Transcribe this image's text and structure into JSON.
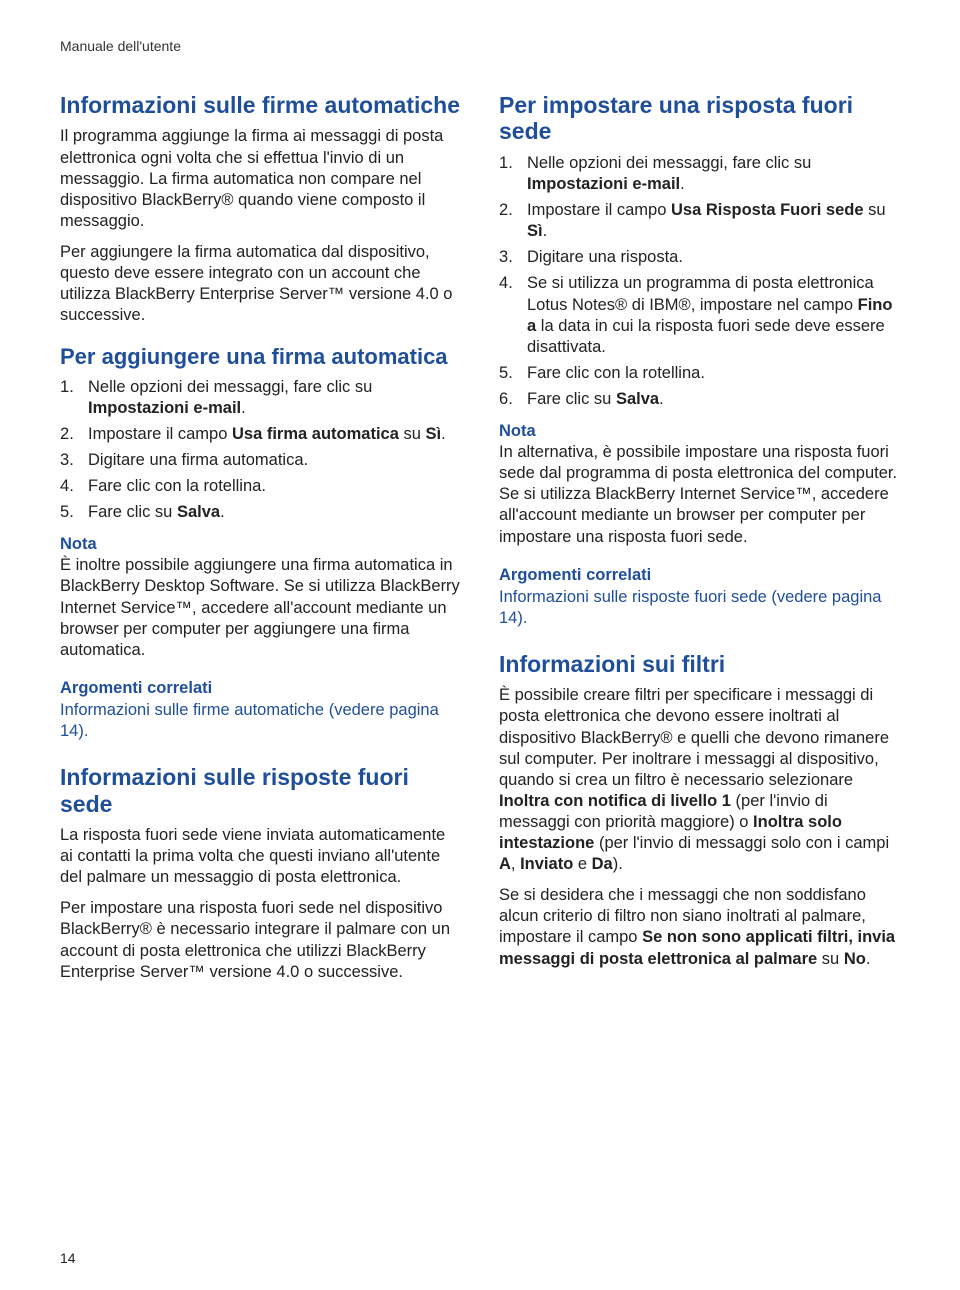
{
  "header": "Manuale dell'utente",
  "pageNumber": "14",
  "left": {
    "h1": "Informazioni sulle firme automatiche",
    "p1": "Il programma aggiunge la firma ai messaggi di posta elettronica ogni volta che si effettua l'invio di un messaggio. La firma automatica non compare nel dispositivo BlackBerry® quando viene composto il messaggio.",
    "p2": "Per aggiungere la firma automatica dal dispositivo, questo deve essere integrato con un account che utilizza BlackBerry Enterprise Server™ versione 4.0 o successive.",
    "h2": "Per aggiungere una firma automatica",
    "ol1_1a": "Nelle opzioni dei messaggi, fare clic su ",
    "ol1_1b": "Impostazioni e-mail",
    "ol1_1c": ".",
    "ol1_2a": "Impostare il campo ",
    "ol1_2b": "Usa firma automatica",
    "ol1_2c": " su ",
    "ol1_2d": "Sì",
    "ol1_2e": ".",
    "ol1_3": "Digitare una firma automatica.",
    "ol1_4": "Fare clic con la rotellina.",
    "ol1_5a": "Fare clic su ",
    "ol1_5b": "Salva",
    "ol1_5c": ".",
    "notaLabel": "Nota",
    "nota1": "È inoltre possibile aggiungere una firma automatica in BlackBerry Desktop Software. Se si utilizza BlackBerry Internet Service™, accedere all'account mediante un browser per computer per aggiungere una firma automatica.",
    "relatedLabel": "Argomenti correlati",
    "related1": "Informazioni sulle firme automatiche (vedere pagina 14).",
    "h3": "Informazioni sulle risposte fuori sede",
    "p3": "La risposta fuori sede viene inviata automaticamente ai contatti la prima volta che questi inviano all'utente del palmare un messaggio di posta elettronica.",
    "p4": "Per impostare una risposta fuori sede nel dispositivo BlackBerry® è necessario integrare il palmare con un account di posta elettronica che utilizzi BlackBerry Enterprise Server™ versione 4.0 o successive."
  },
  "right": {
    "h1": "Per impostare una risposta fuori sede",
    "ol1_1a": "Nelle opzioni dei messaggi, fare clic su ",
    "ol1_1b": "Impostazioni e-mail",
    "ol1_1c": ".",
    "ol1_2a": "Impostare il campo ",
    "ol1_2b": "Usa Risposta Fuori sede",
    "ol1_2c": " su ",
    "ol1_2d": "Sì",
    "ol1_2e": ".",
    "ol1_3": "Digitare una risposta.",
    "ol1_4a": "Se si utilizza un programma di posta elettronica Lotus Notes® di IBM®, impostare nel campo ",
    "ol1_4b": "Fino a",
    "ol1_4c": " la data in cui la risposta fuori sede deve essere disattivata.",
    "ol1_5": "Fare clic con la rotellina.",
    "ol1_6a": "Fare clic su ",
    "ol1_6b": "Salva",
    "ol1_6c": ".",
    "notaLabel": "Nota",
    "nota1": "In alternativa, è possibile impostare una risposta fuori sede dal programma di posta elettronica del computer. Se si utilizza BlackBerry Internet Service™, accedere all'account mediante un browser per computer per impostare una risposta fuori sede.",
    "relatedLabel": "Argomenti correlati",
    "related1": "Informazioni sulle risposte fuori sede (vedere pagina 14).",
    "h2": "Informazioni sui filtri",
    "p1a": "È possibile creare filtri per specificare i messaggi di posta elettronica che devono essere inoltrati al dispositivo BlackBerry® e quelli che devono rimanere sul computer. Per inoltrare i messaggi al dispositivo, quando si crea un filtro è necessario selezionare ",
    "p1b": "Inoltra con notifica di livello 1",
    "p1c": " (per l'invio di messaggi con priorità maggiore) o ",
    "p1d": "Inoltra solo intestazione",
    "p1e": " (per l'invio di messaggi solo con i campi ",
    "p1f": "A",
    "p1g": ", ",
    "p1h": "Inviato",
    "p1i": " e ",
    "p1j": "Da",
    "p1k": ").",
    "p2a": "Se si desidera che i messaggi che non soddisfano alcun criterio di filtro non siano inoltrati al palmare, impostare il campo ",
    "p2b": "Se non sono applicati filtri, invia messaggi di posta elettronica al palmare",
    "p2c": " su ",
    "p2d": "No",
    "p2e": "."
  }
}
